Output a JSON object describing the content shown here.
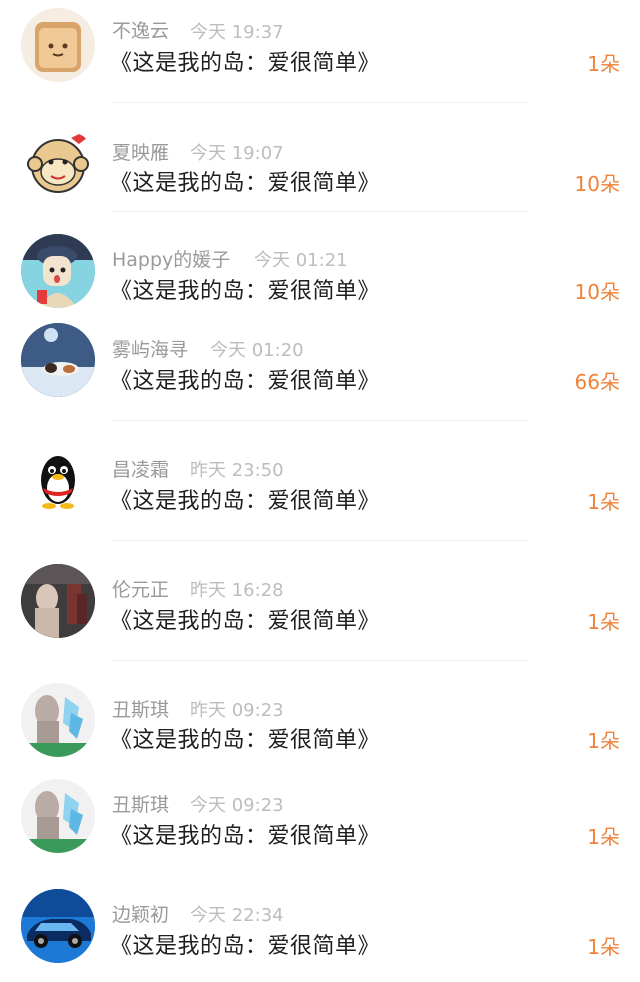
{
  "items": [
    {
      "name": "不逸云",
      "time": "今天 19:37",
      "title": "《这是我的岛：爱很简单》",
      "count": "1朵",
      "avatar": "toast-icon"
    },
    {
      "name": "夏映雁",
      "time": "今天 19:07",
      "title": "《这是我的岛：爱很简单》",
      "count": "10朵",
      "avatar": "monkey-icon"
    },
    {
      "name": "Happy的媛子",
      "time": "今天 01:21",
      "title": "《这是我的岛：爱很简单》",
      "count": "10朵",
      "avatar": "cartoon-girl-icon"
    },
    {
      "name": "雾屿海寻",
      "time": "今天 01:20",
      "title": "《这是我的岛：爱很简单》",
      "count": "66朵",
      "avatar": "cat-photo-icon"
    },
    {
      "name": "昌凌霜",
      "time": "昨天 23:50",
      "title": "《这是我的岛：爱很简单》",
      "count": "1朵",
      "avatar": "penguin-icon"
    },
    {
      "name": "伦元正",
      "time": "昨天 16:28",
      "title": "《这是我的岛：爱很简单》",
      "count": "1朵",
      "avatar": "photo-icon"
    },
    {
      "name": "丑斯琪",
      "time": "昨天 09:23",
      "title": "《这是我的岛：爱很简单》",
      "count": "1朵",
      "avatar": "statue-photo-icon"
    },
    {
      "name": "丑斯琪",
      "time": "今天 09:23",
      "title": "《这是我的岛：爱很简单》",
      "count": "1朵",
      "avatar": "statue-photo-icon"
    },
    {
      "name": "边颖初",
      "time": "今天 22:34",
      "title": "《这是我的岛：爱很简单》",
      "count": "1朵",
      "avatar": "car-icon"
    }
  ],
  "colors": {
    "accent": "#f0823a",
    "name": "#9a9a9a",
    "time": "#bdbdbd",
    "title": "#1e1e1e"
  }
}
